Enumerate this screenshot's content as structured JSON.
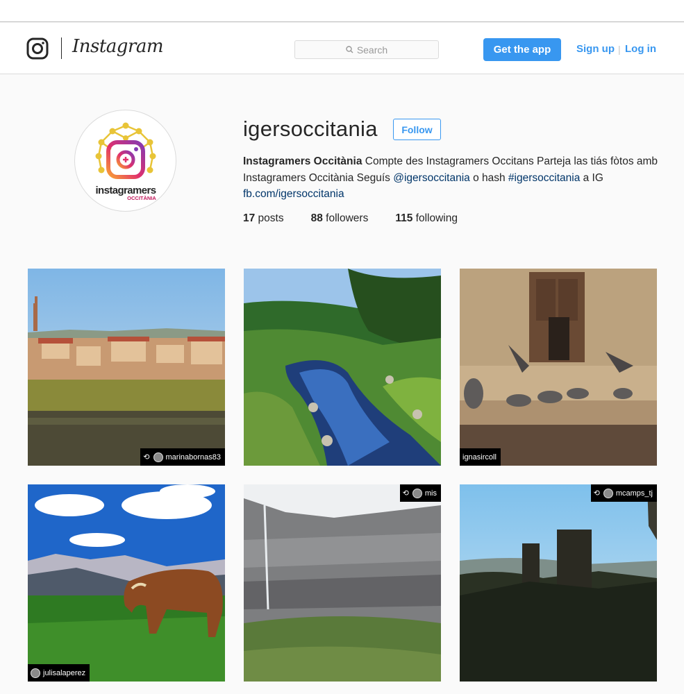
{
  "nav": {
    "wordmark": "Instagram",
    "search_placeholder": "Search",
    "get_app_label": "Get the app",
    "signup_label": "Sign up",
    "separator": "|",
    "login_label": "Log in"
  },
  "profile": {
    "avatar_logo_text": "instagramers OCCITÀNIA",
    "username": "igersoccitania",
    "follow_label": "Follow",
    "bio": {
      "full_name": "Instagramers Occitània",
      "text_1": " Compte des Instagramers Occitans Parteja las tiás fòtos amb Instagramers Occitània Seguís ",
      "mention": "@igersoccitania",
      "text_2": " o hash ",
      "hashtag": "#igersoccitania",
      "text_3": " a IG",
      "link": "fb.com/igersoccitania"
    },
    "stats": {
      "posts_count": "17",
      "posts_label": " posts",
      "followers_count": "88",
      "followers_label": " followers",
      "following_count": "115",
      "following_label": " following"
    }
  },
  "posts": [
    {
      "tag": "marinabornas83"
    },
    {
      "tag": ""
    },
    {
      "tag": "ignasircoll"
    },
    {
      "tag": "julisalaperez"
    },
    {
      "tag": "mis"
    },
    {
      "tag": "mcamps_tj"
    }
  ],
  "colors": {
    "accent": "#3897f0",
    "link": "#003569",
    "background": "#fafafa"
  }
}
